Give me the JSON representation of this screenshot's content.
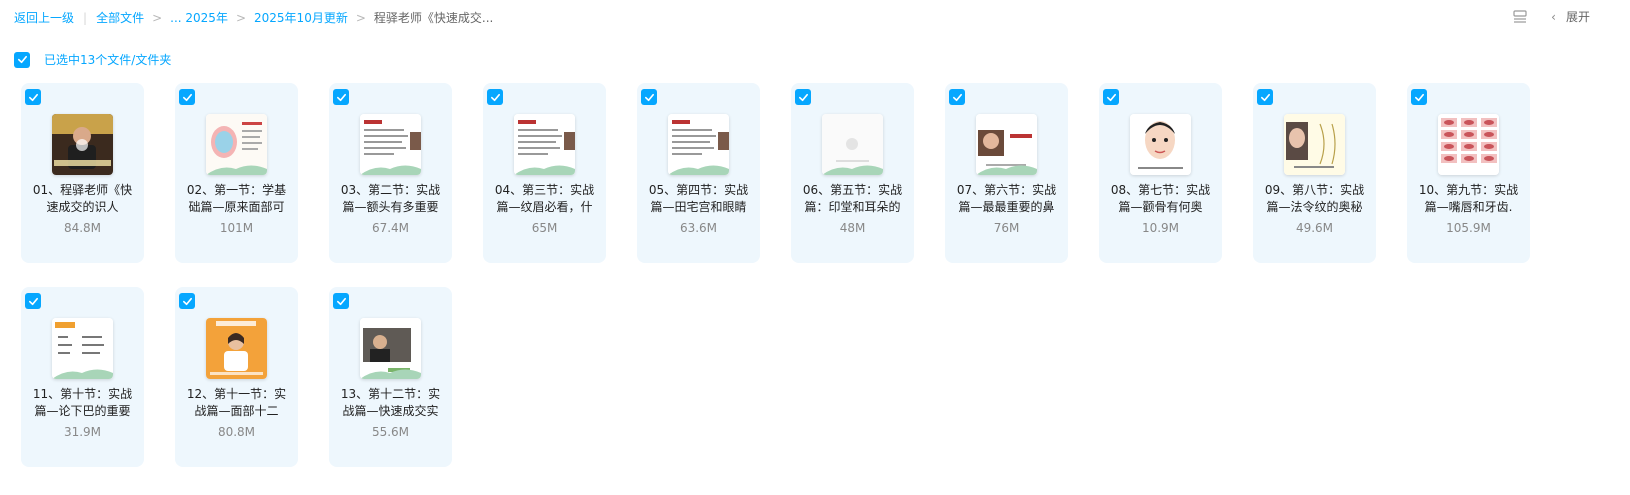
{
  "breadcrumb": {
    "back": "返回上一级",
    "all_files": "全部文件",
    "ellipsis_year": "... 2025年",
    "month": "2025年10月更新",
    "current": "程驿老师《快速成交..."
  },
  "header": {
    "expand_label": "展开",
    "view_icon": "list-view-icon",
    "collapse_icon": "chevron-left-icon"
  },
  "selection": {
    "label": "已选中13个文件/文件夹"
  },
  "colors": {
    "accent": "#06a7ff",
    "card_bg": "#eef7fd"
  },
  "files": [
    {
      "name": "01、程驿老师《快速成交的识人",
      "size": "84.8M",
      "thumb": "video-person"
    },
    {
      "name": "02、第一节：学基础篇—原来面部可",
      "size": "101M",
      "thumb": "face-chart"
    },
    {
      "name": "03、第二节：实战篇—额头有多重要",
      "size": "67.4M",
      "thumb": "text-slide"
    },
    {
      "name": "04、第三节：实战篇—纹眉必看，什",
      "size": "65M",
      "thumb": "text-slide"
    },
    {
      "name": "05、第四节：实战篇—田宅宫和眼睛",
      "size": "63.6M",
      "thumb": "text-slide"
    },
    {
      "name": "06、第五节：实战篇：印堂和耳朵的",
      "size": "48M",
      "thumb": "blank-slide"
    },
    {
      "name": "07、第六节：实战篇—最最重要的鼻",
      "size": "76M",
      "thumb": "nose-slide"
    },
    {
      "name": "08、第七节：实战篇—颧骨有何奥",
      "size": "10.9M",
      "thumb": "cartoon-face"
    },
    {
      "name": "09、第八节：实战篇—法令纹的奥秘",
      "size": "49.6M",
      "thumb": "lines-slide"
    },
    {
      "name": "10、第九节：实战篇—嘴唇和牙齿.",
      "size": "105.9M",
      "thumb": "lips-grid"
    },
    {
      "name": "11、第十节：实战篇—论下巴的重要",
      "size": "31.9M",
      "thumb": "chart-slide"
    },
    {
      "name": "12、第十一节：实战篇—面部十二",
      "size": "80.8M",
      "thumb": "orange-person"
    },
    {
      "name": "13、第十二节：实战篇—快速成交实",
      "size": "55.6M",
      "thumb": "video-man"
    }
  ]
}
